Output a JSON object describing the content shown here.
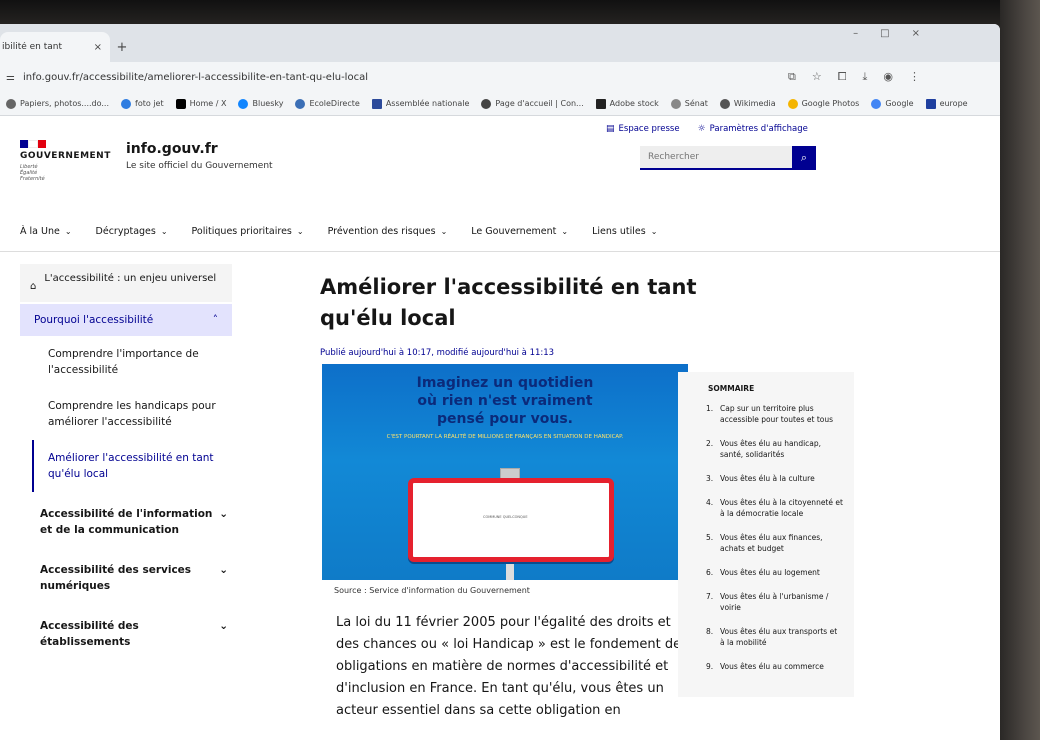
{
  "browser": {
    "tab_title": "ibilité en tant",
    "tab_close": "×",
    "new_tab": "+",
    "window_controls": [
      "–",
      "□",
      "×"
    ],
    "url": "info.gouv.fr/accessibilite/ameliorer-l-accessibilite-en-tant-qu-elu-local",
    "bookmarks": [
      "Papiers, photos....do...",
      "foto jet",
      "Home / X",
      "Bluesky",
      "EcoleDirecte",
      "Assemblée nationale",
      "Page d'accueil | Con...",
      "Adobe stock",
      "Sénat",
      "Wikimedia",
      "Google Photos",
      "Google",
      "europe"
    ]
  },
  "header": {
    "gov_name": "GOUVERNEMENT",
    "gov_motto_1": "Liberté",
    "gov_motto_2": "Égalité",
    "gov_motto_3": "Fraternité",
    "site_title": "info.gouv.fr",
    "site_tagline": "Le site officiel du Gouvernement",
    "link_press": "Espace presse",
    "link_display": "Paramètres d'affichage",
    "search_placeholder": "Rechercher"
  },
  "nav": {
    "items": [
      "À la Une",
      "Décryptages",
      "Politiques prioritaires",
      "Prévention des risques",
      "Le Gouvernement",
      "Liens utiles"
    ]
  },
  "sidebar": {
    "home": "L'accessibilité : un enjeu universel",
    "active": "Pourquoi l'accessibilité",
    "subitems": [
      "Comprendre l'importance de l'accessibilité",
      "Comprendre les handicaps pour améliorer l'accessibilité",
      "Améliorer l'accessibilité en tant qu'élu local"
    ],
    "sections": [
      "Accessibilité de l'information et de la communication",
      "Accessibilité des services numériques",
      "Accessibilité des établissements"
    ]
  },
  "article": {
    "title": "Améliorer l'accessibilité en tant qu'élu local",
    "published": "Publié aujourd'hui à 10:17, modifié aujourd'hui à 11:13",
    "hero_line_1": "Imaginez un quotidien",
    "hero_line_2": "où rien n'est vraiment",
    "hero_line_3": "pensé pour vous.",
    "hero_sub": "C'EST POURTANT LA RÉALITÉ DE MILLIONS DE FRANÇAIS EN SITUATION DE HANDICAP.",
    "sign_text": "COMMUNE QUELCONQUE",
    "source": "Source : Service d'information du Gouvernement",
    "body": "La loi du 11 février 2005 pour l'égalité des droits et des chances ou « loi Handicap » est le fondement des obligations en matière de normes d'accessibilité et d'inclusion en France. En tant qu'élu, vous êtes un acteur essentiel dans sa cette obligation en"
  },
  "toc": {
    "title": "SOMMAIRE",
    "items": [
      {
        "num": "1.",
        "text": "Cap sur un territoire plus accessible pour toutes et tous"
      },
      {
        "num": "2.",
        "text": "Vous êtes élu au handicap, santé, solidarités"
      },
      {
        "num": "3.",
        "text": "Vous êtes élu à la culture"
      },
      {
        "num": "4.",
        "text": "Vous êtes élu à la citoyenneté et à la démocratie locale"
      },
      {
        "num": "5.",
        "text": "Vous êtes élu aux finances, achats et budget"
      },
      {
        "num": "6.",
        "text": "Vous êtes élu au logement"
      },
      {
        "num": "7.",
        "text": "Vous êtes élu à l'urbanisme / voirie"
      },
      {
        "num": "8.",
        "text": "Vous êtes élu aux transports et à la mobilité"
      },
      {
        "num": "9.",
        "text": "Vous êtes élu au commerce"
      }
    ]
  },
  "colors": {
    "brand_blue": "#000091",
    "flag_blue": "#000091",
    "flag_white": "#ffffff",
    "flag_red": "#e1000f"
  }
}
